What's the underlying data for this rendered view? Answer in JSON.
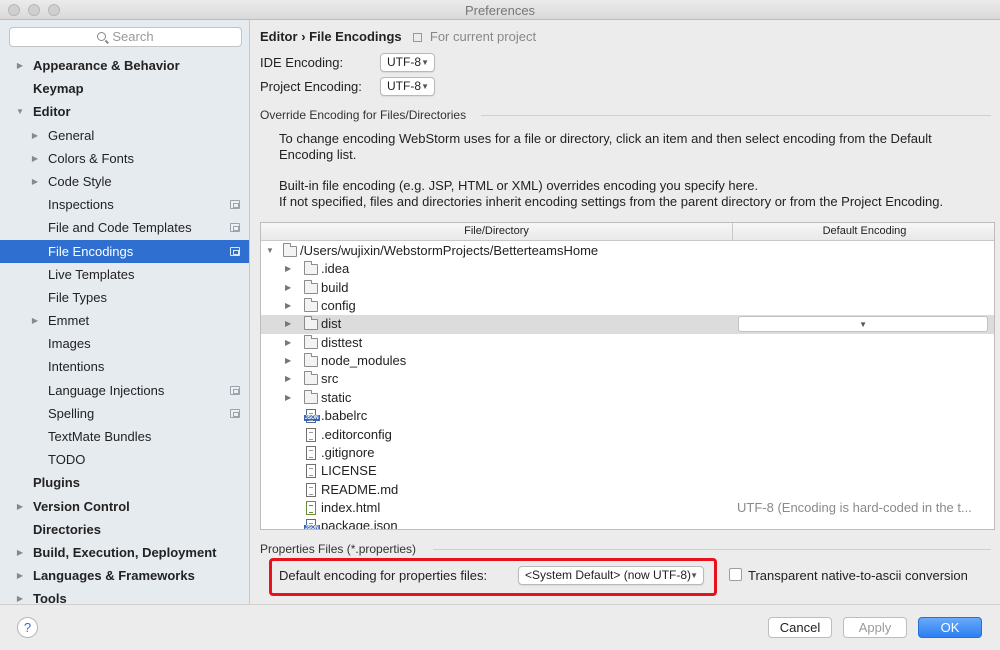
{
  "window": {
    "title": "Preferences"
  },
  "search": {
    "placeholder": "Search"
  },
  "sidebar": {
    "items": [
      {
        "label": "Appearance & Behavior",
        "level": 0,
        "bold": true,
        "expandable": true,
        "expanded": false,
        "project": false,
        "selected": false
      },
      {
        "label": "Keymap",
        "level": 0,
        "bold": true,
        "expandable": false,
        "expanded": false,
        "project": false,
        "selected": false
      },
      {
        "label": "Editor",
        "level": 0,
        "bold": true,
        "expandable": true,
        "expanded": true,
        "project": false,
        "selected": false
      },
      {
        "label": "General",
        "level": 1,
        "bold": false,
        "expandable": true,
        "expanded": false,
        "project": false,
        "selected": false
      },
      {
        "label": "Colors & Fonts",
        "level": 1,
        "bold": false,
        "expandable": true,
        "expanded": false,
        "project": false,
        "selected": false
      },
      {
        "label": "Code Style",
        "level": 1,
        "bold": false,
        "expandable": true,
        "expanded": false,
        "project": false,
        "selected": false
      },
      {
        "label": "Inspections",
        "level": 1,
        "bold": false,
        "expandable": false,
        "expanded": false,
        "project": true,
        "selected": false
      },
      {
        "label": "File and Code Templates",
        "level": 1,
        "bold": false,
        "expandable": false,
        "expanded": false,
        "project": true,
        "selected": false
      },
      {
        "label": "File Encodings",
        "level": 1,
        "bold": false,
        "expandable": false,
        "expanded": false,
        "project": true,
        "selected": true
      },
      {
        "label": "Live Templates",
        "level": 1,
        "bold": false,
        "expandable": false,
        "expanded": false,
        "project": false,
        "selected": false
      },
      {
        "label": "File Types",
        "level": 1,
        "bold": false,
        "expandable": false,
        "expanded": false,
        "project": false,
        "selected": false
      },
      {
        "label": "Emmet",
        "level": 1,
        "bold": false,
        "expandable": true,
        "expanded": false,
        "project": false,
        "selected": false
      },
      {
        "label": "Images",
        "level": 1,
        "bold": false,
        "expandable": false,
        "expanded": false,
        "project": false,
        "selected": false
      },
      {
        "label": "Intentions",
        "level": 1,
        "bold": false,
        "expandable": false,
        "expanded": false,
        "project": false,
        "selected": false
      },
      {
        "label": "Language Injections",
        "level": 1,
        "bold": false,
        "expandable": false,
        "expanded": false,
        "project": true,
        "selected": false
      },
      {
        "label": "Spelling",
        "level": 1,
        "bold": false,
        "expandable": false,
        "expanded": false,
        "project": true,
        "selected": false
      },
      {
        "label": "TextMate Bundles",
        "level": 1,
        "bold": false,
        "expandable": false,
        "expanded": false,
        "project": false,
        "selected": false
      },
      {
        "label": "TODO",
        "level": 1,
        "bold": false,
        "expandable": false,
        "expanded": false,
        "project": false,
        "selected": false
      },
      {
        "label": "Plugins",
        "level": 0,
        "bold": true,
        "expandable": false,
        "expanded": false,
        "project": false,
        "selected": false
      },
      {
        "label": "Version Control",
        "level": 0,
        "bold": true,
        "expandable": true,
        "expanded": false,
        "project": false,
        "selected": false
      },
      {
        "label": "Directories",
        "level": 0,
        "bold": true,
        "expandable": false,
        "expanded": false,
        "project": false,
        "selected": false
      },
      {
        "label": "Build, Execution, Deployment",
        "level": 0,
        "bold": true,
        "expandable": true,
        "expanded": false,
        "project": false,
        "selected": false
      },
      {
        "label": "Languages & Frameworks",
        "level": 0,
        "bold": true,
        "expandable": true,
        "expanded": false,
        "project": false,
        "selected": false
      },
      {
        "label": "Tools",
        "level": 0,
        "bold": true,
        "expandable": true,
        "expanded": false,
        "project": false,
        "selected": false
      }
    ]
  },
  "breadcrumb": {
    "parent": "Editor",
    "separator": "›",
    "current": "File Encodings",
    "scope_hint": "For current project"
  },
  "encodings": {
    "ide_label": "IDE Encoding:",
    "ide_value": "UTF-8",
    "project_label": "Project Encoding:",
    "project_value": "UTF-8"
  },
  "override": {
    "title": "Override Encoding for Files/Directories",
    "desc1a": "To change encoding WebStorm uses for a file or directory, click an item and then select encoding from the Default",
    "desc1b": "Encoding list.",
    "desc2a": "Built-in file encoding (e.g. JSP, HTML or XML) overrides encoding you specify here.",
    "desc2b": "If not specified, files and directories inherit encoding settings from the parent directory or from the Project Encoding."
  },
  "table": {
    "col_file": "File/Directory",
    "col_encoding": "Default Encoding",
    "rows": [
      {
        "name": "/Users/wujixin/WebstormProjects/BetterteamsHome",
        "kind": "folder",
        "depth": 0,
        "expanded": true,
        "encoding": ""
      },
      {
        "name": ".idea",
        "kind": "folder",
        "depth": 1,
        "expanded": false,
        "encoding": ""
      },
      {
        "name": "build",
        "kind": "folder",
        "depth": 1,
        "expanded": false,
        "encoding": ""
      },
      {
        "name": "config",
        "kind": "folder",
        "depth": 1,
        "expanded": false,
        "encoding": ""
      },
      {
        "name": "dist",
        "kind": "folder",
        "depth": 1,
        "expanded": false,
        "encoding": "",
        "highlighted": true
      },
      {
        "name": "disttest",
        "kind": "folder",
        "depth": 1,
        "expanded": false,
        "encoding": ""
      },
      {
        "name": "node_modules",
        "kind": "folder",
        "depth": 1,
        "expanded": false,
        "encoding": ""
      },
      {
        "name": "src",
        "kind": "folder",
        "depth": 1,
        "expanded": false,
        "encoding": ""
      },
      {
        "name": "static",
        "kind": "folder",
        "depth": 1,
        "expanded": false,
        "encoding": ""
      },
      {
        "name": ".babelrc",
        "kind": "json",
        "depth": 1,
        "encoding": ""
      },
      {
        "name": ".editorconfig",
        "kind": "file",
        "depth": 1,
        "encoding": ""
      },
      {
        "name": ".gitignore",
        "kind": "file",
        "depth": 1,
        "encoding": ""
      },
      {
        "name": "LICENSE",
        "kind": "file",
        "depth": 1,
        "encoding": ""
      },
      {
        "name": "README.md",
        "kind": "file",
        "depth": 1,
        "encoding": ""
      },
      {
        "name": "index.html",
        "kind": "html",
        "depth": 1,
        "encoding": "UTF-8 (Encoding is hard-coded in the t..."
      },
      {
        "name": "package.json",
        "kind": "json",
        "depth": 1,
        "encoding": ""
      }
    ]
  },
  "properties": {
    "title": "Properties Files (*.properties)",
    "default_label": "Default encoding for properties files:",
    "default_value": "<System Default> (now UTF-8)",
    "transparent_label": "Transparent native-to-ascii conversion",
    "transparent_checked": false
  },
  "footer": {
    "help": "?",
    "cancel": "Cancel",
    "apply": "Apply",
    "ok": "OK"
  },
  "colors": {
    "selection": "#2f6fcf",
    "highlight_box": "#e8121e",
    "ok_button": "#2b7ff2"
  }
}
